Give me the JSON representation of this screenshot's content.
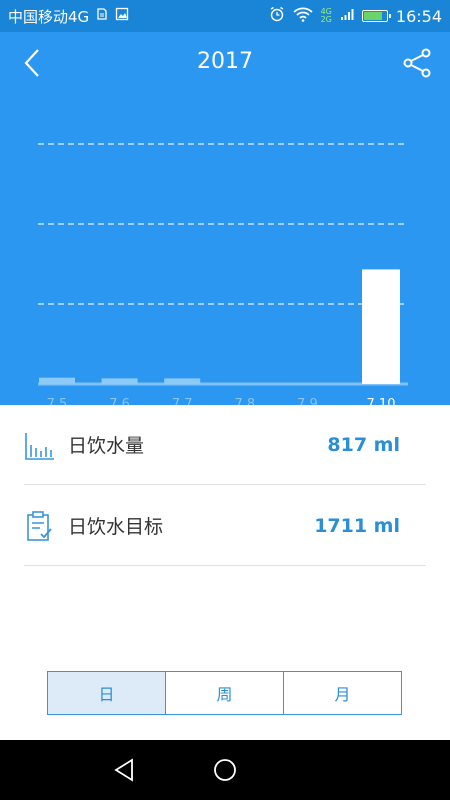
{
  "status_bar": {
    "carrier": "中国移动4G",
    "time": "16:54",
    "network_badges": [
      "4G",
      "2G"
    ]
  },
  "header": {
    "title": "2017",
    "back_icon": "back-arrow-icon",
    "share_icon": "share-icon"
  },
  "chart_data": {
    "type": "bar",
    "categories": [
      "7.5",
      "7.6",
      "7.7",
      "7.8",
      "7.9",
      "7.10"
    ],
    "values": [
      45,
      40,
      40,
      0,
      0,
      817
    ],
    "ylim": [
      0,
      1711
    ],
    "grid": true,
    "highlight_category": "7.10"
  },
  "stats": [
    {
      "icon": "bar-chart-icon",
      "label": "日饮水量",
      "value": "817 ml"
    },
    {
      "icon": "clipboard-check-icon",
      "label": "日饮水目标",
      "value": "1711 ml"
    }
  ],
  "period_tabs": [
    {
      "label": "日",
      "active": true
    },
    {
      "label": "周",
      "active": false
    },
    {
      "label": "月",
      "active": false
    }
  ],
  "nav_bar": {
    "back": "triangle-back-icon",
    "home": "circle-home-icon"
  },
  "colors": {
    "primary": "#2b97f0",
    "status_bar": "#1a84d6",
    "accent_text": "#2b8fd6",
    "bar": "#ffffff"
  }
}
